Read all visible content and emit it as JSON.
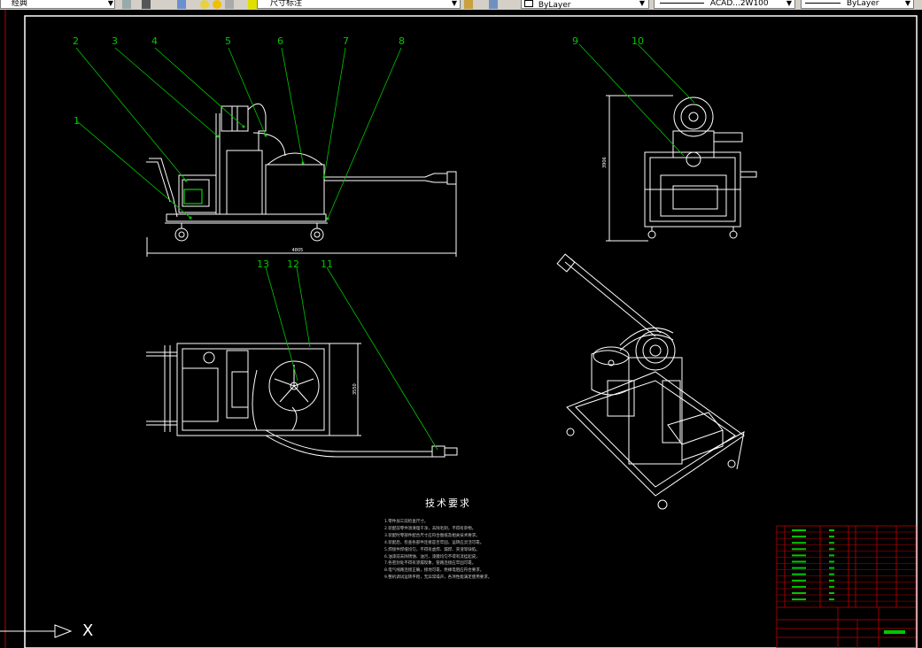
{
  "toolbar": {
    "workspace": "经典",
    "dim_style": "尺寸标注",
    "color": "ByLayer",
    "linetype": "ACAD...2W100",
    "lineweight": "ByLayer"
  },
  "drawing": {
    "balloons_front": [
      "1",
      "2",
      "3",
      "4",
      "5",
      "6",
      "7",
      "8"
    ],
    "balloons_side": [
      "9",
      "10"
    ],
    "balloons_top": [
      "13",
      "12",
      "11"
    ],
    "dim_front_width": "4805",
    "dim_side_height": "3906",
    "dim_top_height": "3550"
  },
  "notes": {
    "title": "技术要求",
    "lines": [
      "1.零件加工前检查尺寸。",
      "2.装配前零件须清理干净，去除毛刺，不得有杂物。",
      "3.装配时零部件配合尺寸应符合图纸及相关技术要求。",
      "4.装配后，检查各部件连接是否牢固，运转应灵活可靠。",
      "5.焊接件焊缝均匀，不得有虚焊、漏焊、夹渣等缺陷。",
      "6.油漆前去除锈蚀、油污，漆膜均匀不得有流挂起皮。",
      "7.各密封处不得有渗漏现象，管路连接应牢固可靠。",
      "8.电气线路连接正确，接地可靠，绝缘电阻应符合要求。",
      "9.整机调试运转平稳，无异常噪声，各项性能满足使用要求。"
    ]
  },
  "axis": {
    "x_label": "X"
  }
}
